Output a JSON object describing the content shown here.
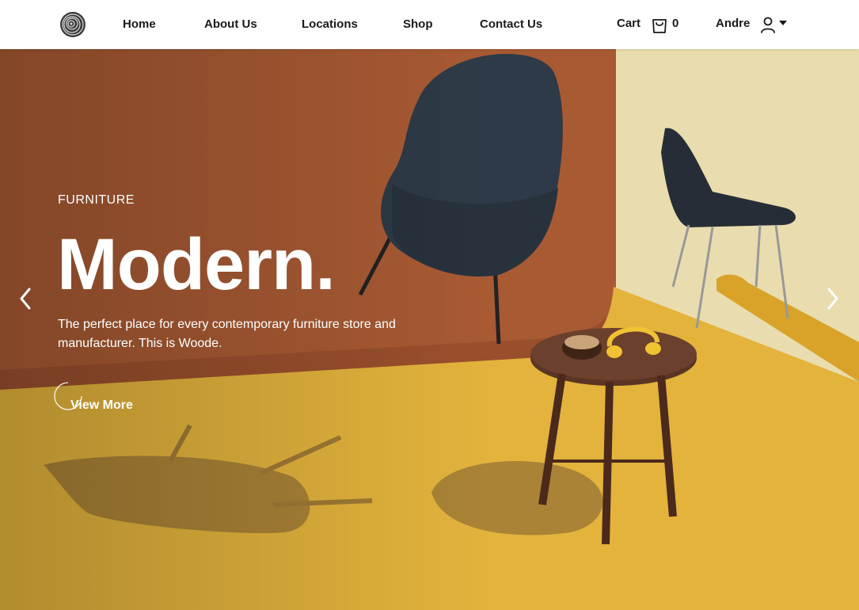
{
  "nav": {
    "logo_icon": "wood-ring-logo-icon",
    "links": [
      "Home",
      "About Us",
      "Locations",
      "Shop",
      "Contact Us"
    ],
    "cart_label": "Cart",
    "cart_icon": "shopping-bag-icon",
    "cart_count": "0",
    "user_name": "Andre",
    "user_icon": "user-icon",
    "dropdown_icon": "caret-down-icon"
  },
  "hero": {
    "eyebrow": "FURNITURE",
    "headline": "Modern.",
    "description": "The perfect place for every contemporary furniture store and manufacturer. This is Woode.",
    "cta_label": "View More",
    "prev_icon": "chevron-left-icon",
    "next_icon": "chevron-right-icon"
  },
  "colors": {
    "floor": "#e3b33c",
    "wall_terracotta": "#a85a33",
    "wall_cream": "#e9dcae",
    "chair_dark": "#2e3a47",
    "table_wood": "#5a3524"
  }
}
